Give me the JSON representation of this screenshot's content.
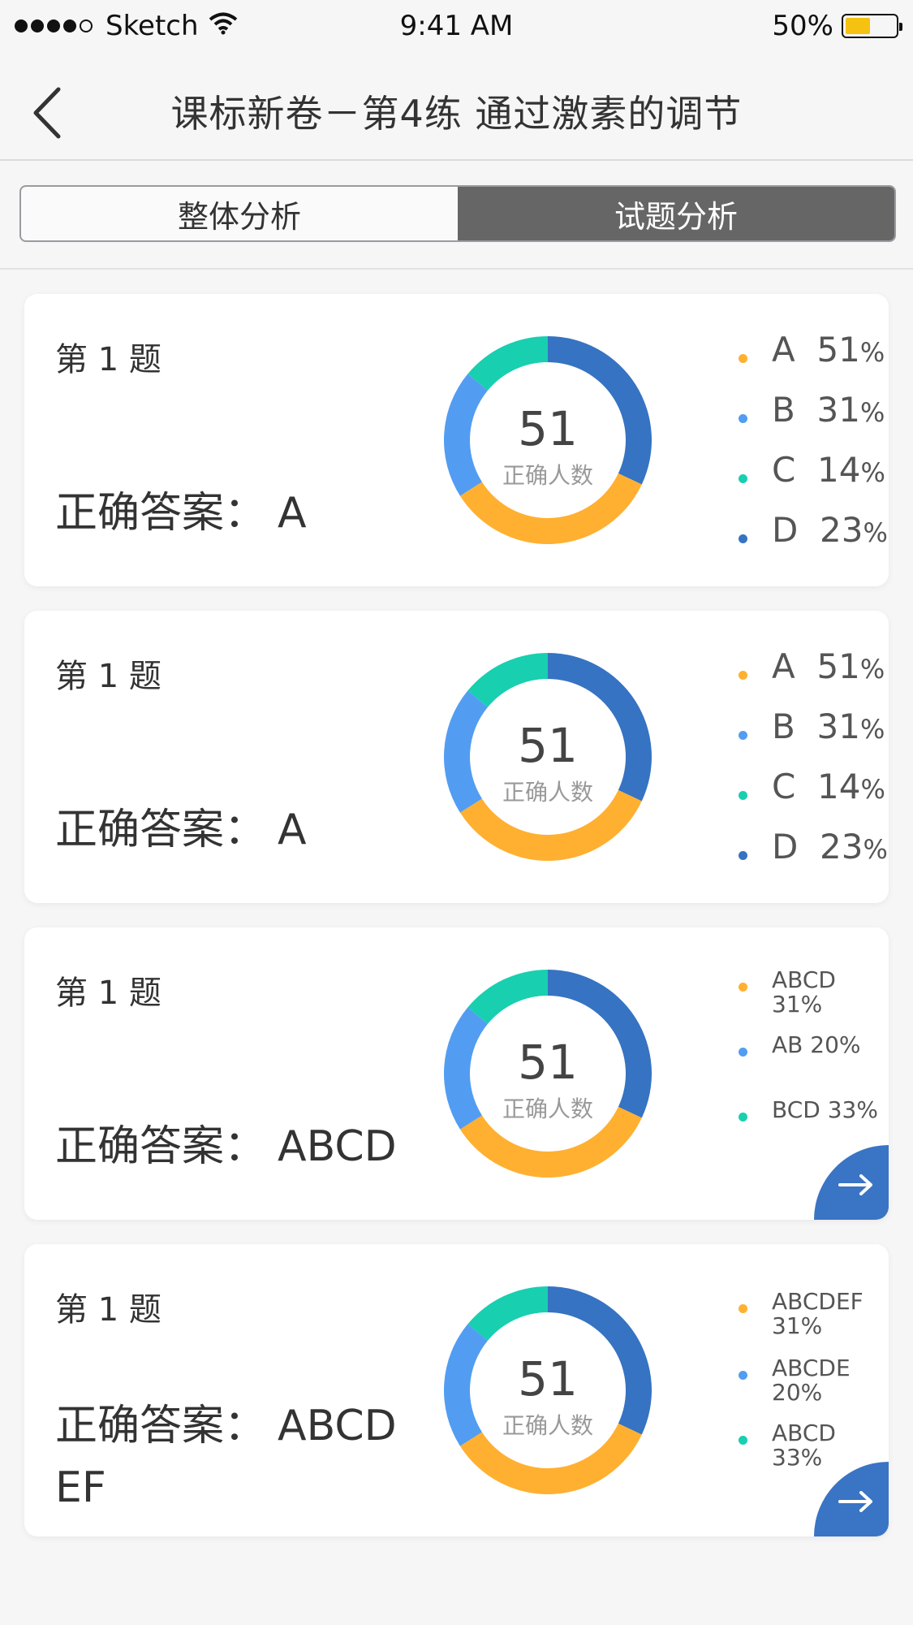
{
  "status": {
    "carrier": "Sketch",
    "time": "9:41 AM",
    "battery": "50%",
    "battery_level": 0.5
  },
  "nav": {
    "title": "课标新卷－第4练 通过激素的调节"
  },
  "tabs": [
    {
      "label": "整体分析",
      "active": false
    },
    {
      "label": "试题分析",
      "active": true
    }
  ],
  "colors": {
    "A": "#ffb031",
    "B": "#529df2",
    "C": "#18cfb0",
    "D": "#3673c2",
    "accent": "#3a74c4"
  },
  "cards": [
    {
      "question": "第 1 题",
      "answer_label": "正确答案：",
      "answer_value": "A",
      "center_value": "51",
      "center_label": "正确人数",
      "legend": [
        {
          "label": "A",
          "value": "51",
          "unit": "%"
        },
        {
          "label": "B",
          "value": "31",
          "unit": "%"
        },
        {
          "label": "C",
          "value": "14",
          "unit": "%"
        },
        {
          "label": "D",
          "value": "23",
          "unit": "%"
        }
      ]
    },
    {
      "question": "第 1 题",
      "answer_label": "正确答案：",
      "answer_value": "A",
      "center_value": "51",
      "center_label": "正确人数",
      "legend": [
        {
          "label": "A",
          "value": "51",
          "unit": "%"
        },
        {
          "label": "B",
          "value": "31",
          "unit": "%"
        },
        {
          "label": "C",
          "value": "14",
          "unit": "%"
        },
        {
          "label": "D",
          "value": "23",
          "unit": "%"
        }
      ]
    },
    {
      "question": "第 1 题",
      "answer_label": "正确答案：",
      "answer_value": "ABCD",
      "center_value": "51",
      "center_label": "正确人数",
      "legend": [
        {
          "text": "ABCD 31%"
        },
        {
          "text": "AB 20%"
        },
        {
          "text": "BCD 33%"
        }
      ]
    },
    {
      "question": "第 1 题",
      "answer_label": "正确答案：",
      "answer_value": "ABCD EF",
      "center_value": "51",
      "center_label": "正确人数",
      "legend": [
        {
          "line1": "ABCDEF",
          "line2": "31%"
        },
        {
          "line1": "ABCDE",
          "line2": "20%"
        },
        {
          "line1": "ABCD",
          "line2": "33%"
        }
      ]
    }
  ],
  "chart_data": [
    {
      "type": "pie",
      "categories": [
        "A",
        "B",
        "C",
        "D"
      ],
      "values": [
        34,
        20,
        14,
        32
      ],
      "title": "",
      "center_value": 51
    },
    {
      "type": "pie",
      "categories": [
        "A",
        "B",
        "C",
        "D"
      ],
      "values": [
        34,
        20,
        14,
        32
      ],
      "title": "",
      "center_value": 51
    },
    {
      "type": "pie",
      "categories": [
        "A",
        "B",
        "C",
        "D"
      ],
      "values": [
        34,
        20,
        14,
        32
      ],
      "title": "",
      "center_value": 51
    },
    {
      "type": "pie",
      "categories": [
        "A",
        "B",
        "C",
        "D"
      ],
      "values": [
        34,
        20,
        14,
        32
      ],
      "title": "",
      "center_value": 51
    }
  ]
}
